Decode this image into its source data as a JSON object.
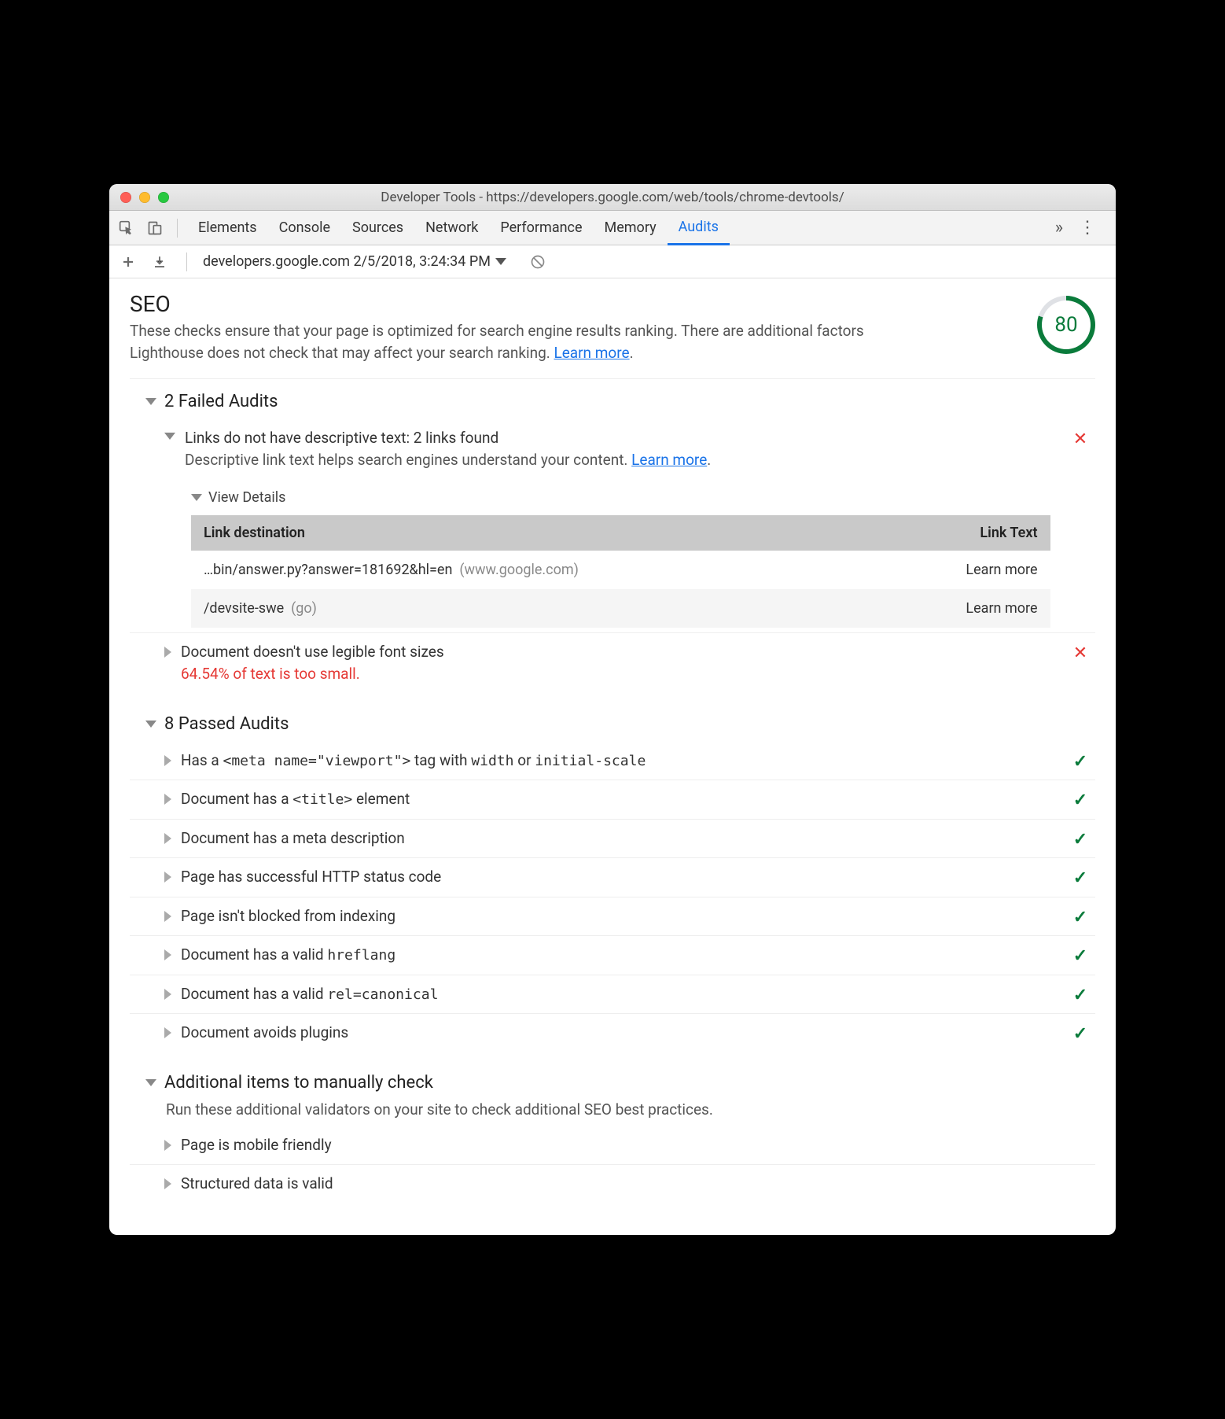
{
  "window": {
    "title": "Developer Tools - https://developers.google.com/web/tools/chrome-devtools/"
  },
  "tabs": {
    "items": [
      "Elements",
      "Console",
      "Sources",
      "Network",
      "Performance",
      "Memory",
      "Audits"
    ],
    "active": "Audits"
  },
  "toolbar": {
    "run_label": "developers.google.com 2/5/2018, 3:24:34 PM"
  },
  "seo": {
    "heading": "SEO",
    "description_a": "These checks ensure that your page is optimized for search engine results ranking. There are additional factors Lighthouse does not check that may affect your search ranking. ",
    "learn_more": "Learn more",
    "score": 80
  },
  "failed": {
    "title": "2 Failed Audits",
    "items": [
      {
        "title": "Links do not have descriptive text: 2 links found",
        "description": "Descriptive link text helps search engines understand your content. ",
        "learn_more": "Learn more",
        "expanded": true,
        "view_details": "View Details",
        "table": {
          "col1": "Link destination",
          "col2": "Link Text",
          "rows": [
            {
              "dest": "…bin/answer.py?answer=181692&hl=en",
              "host": "(www.google.com)",
              "text": "Learn more"
            },
            {
              "dest": "/devsite-swe",
              "host": "(go)",
              "text": "Learn more"
            }
          ]
        }
      },
      {
        "title": "Document doesn't use legible font sizes",
        "subline": "64.54% of text is too small.",
        "expanded": false
      }
    ]
  },
  "passed": {
    "title": "8 Passed Audits",
    "items": [
      {
        "html": "Has a <code>&lt;meta name=\"viewport\"&gt;</code> tag with <code>width</code> or <code>initial-scale</code>"
      },
      {
        "html": "Document has a <code>&lt;title&gt;</code> element"
      },
      {
        "html": "Document has a meta description"
      },
      {
        "html": "Page has successful HTTP status code"
      },
      {
        "html": "Page isn't blocked from indexing"
      },
      {
        "html": "Document has a valid <code>hreflang</code>"
      },
      {
        "html": "Document has a valid <code>rel=canonical</code>"
      },
      {
        "html": "Document avoids plugins"
      }
    ]
  },
  "manual": {
    "title": "Additional items to manually check",
    "description": "Run these additional validators on your site to check additional SEO best practices.",
    "items": [
      {
        "title": "Page is mobile friendly"
      },
      {
        "title": "Structured data is valid"
      }
    ]
  }
}
